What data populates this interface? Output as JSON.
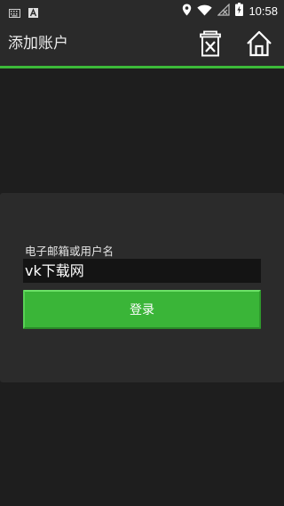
{
  "status_bar": {
    "time": "10:58",
    "left_icons": [
      "keyboard-icon",
      "a-app-icon"
    ],
    "right_icons": [
      "location-icon",
      "wifi-icon",
      "no-signal-icon",
      "battery-charging-icon"
    ]
  },
  "app_bar": {
    "title": "添加账户",
    "actions": [
      "delete-icon",
      "home-icon"
    ]
  },
  "form": {
    "username_label": "电子邮箱或用户名",
    "username_value": "vk下载网",
    "login_button": "登录"
  },
  "colors": {
    "accent": "#3cb939",
    "background": "#1e1e1e",
    "card": "#2b2b2b",
    "input": "#141414"
  }
}
